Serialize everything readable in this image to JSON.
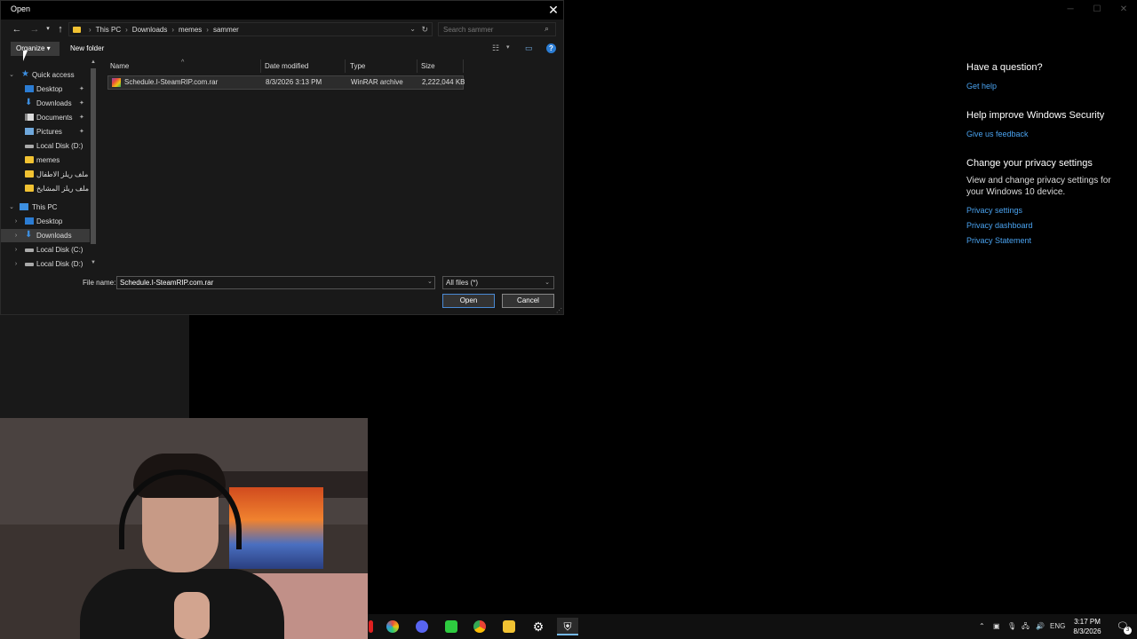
{
  "settings_panel": {
    "question_heading": "Have a question?",
    "get_help": "Get help",
    "improve_heading": "Help improve Windows Security",
    "feedback_link": "Give us feedback",
    "privacy_heading": "Change your privacy settings",
    "privacy_text": "View and change privacy settings for your Windows 10 device.",
    "privacy_settings": "Privacy settings",
    "privacy_dashboard": "Privacy dashboard",
    "privacy_statement": "Privacy Statement"
  },
  "dialog": {
    "title": "Open",
    "close_glyph": "✕",
    "breadcrumbs": [
      "This PC",
      "Downloads",
      "memes",
      "sammer"
    ],
    "search_placeholder": "Search sammer",
    "toolbar": {
      "organize": "Organize ▾",
      "new_folder": "New folder"
    },
    "nav": {
      "quick_access": "Quick access",
      "items": [
        {
          "label": "Desktop",
          "icon": "desktop-icon",
          "pinned": true
        },
        {
          "label": "Downloads",
          "icon": "download-icon",
          "pinned": true
        },
        {
          "label": "Documents",
          "icon": "documents-icon",
          "pinned": true
        },
        {
          "label": "Pictures",
          "icon": "pictures-icon",
          "pinned": true
        },
        {
          "label": "Local Disk (D:)",
          "icon": "drive-icon",
          "pinned": false
        },
        {
          "label": "memes",
          "icon": "folder-icon",
          "pinned": false
        },
        {
          "label": "ملف ريلز الاطفال",
          "icon": "folder-icon",
          "pinned": false
        },
        {
          "label": "ملف ريلز المشايخ",
          "icon": "folder-icon",
          "pinned": false
        }
      ],
      "this_pc": "This PC",
      "pc_items": [
        {
          "label": "Desktop",
          "icon": "desktop-icon"
        },
        {
          "label": "Downloads",
          "icon": "download-icon",
          "selected": true
        },
        {
          "label": "Local Disk (C:)",
          "icon": "drive-icon"
        },
        {
          "label": "Local Disk (D:)",
          "icon": "drive-icon"
        }
      ]
    },
    "columns": [
      "Name",
      "Date modified",
      "Type",
      "Size"
    ],
    "files": [
      {
        "name": "Schedule.I-SteamRIP.com.rar",
        "date": "8/3/2026 3:13 PM",
        "type": "WinRAR archive",
        "size": "2,222,044 KB"
      }
    ],
    "file_name_label": "File name:",
    "file_name_value": "Schedule.I-SteamRIP.com.rar",
    "file_type": "All files (*)",
    "open_button": "Open",
    "cancel_button": "Cancel"
  },
  "taskbar": {
    "tray_lang": "ENG",
    "time": "3:17 PM",
    "date": "8/3/2026",
    "notification_count": "3"
  },
  "colors": {
    "accent": "#2b7cd3",
    "link": "#4aa3f0",
    "folder": "#f1c232"
  }
}
